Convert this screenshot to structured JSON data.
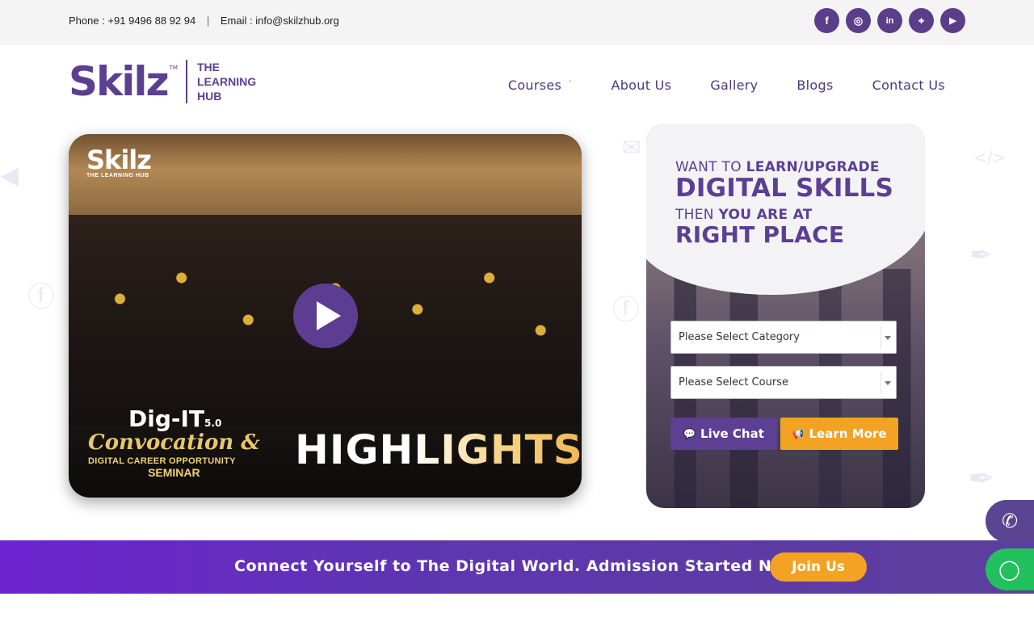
{
  "topbar": {
    "phone": "Phone : +91 9496 88 92 94",
    "separator": "|",
    "email": "Email : info@skilzhub.org",
    "social": [
      {
        "icon": "facebook-icon",
        "glyph": "f"
      },
      {
        "icon": "instagram-icon",
        "glyph": "◎"
      },
      {
        "icon": "linkedin-icon",
        "glyph": "in"
      },
      {
        "icon": "map-pin-icon",
        "glyph": "⌖"
      },
      {
        "icon": "youtube-icon",
        "glyph": "▶"
      }
    ]
  },
  "brand": {
    "logo_word": "Skilz",
    "logo_tm": "TM",
    "tagline_1": "THE",
    "tagline_2": "LEARNING",
    "tagline_3": "HUB",
    "color": "#5c3f93"
  },
  "nav": {
    "courses": "Courses",
    "about": "About Us",
    "gallery": "Gallery",
    "blogs": "Blogs",
    "contact": "Contact Us",
    "chevron": "˅"
  },
  "video": {
    "logo_word": "Skilz",
    "logo_tag": "THE LEARNING HUB",
    "event_title": "Dig-IT",
    "event_version": "5.0",
    "event_line2": "Convocation &",
    "event_line3": "DIGITAL CAREER OPPORTUNITY",
    "event_line4": "SEMINAR",
    "highlights": "HIGHLIGHTS",
    "play_icon": "play-icon"
  },
  "form": {
    "line1_light": "WANT TO ",
    "line1_bold": "LEARN/UPGRADE",
    "line2": "DIGITAL SKILLS",
    "line3_light": "THEN ",
    "line3_bold": "YOU ARE AT",
    "line4": "RIGHT PLACE",
    "category_placeholder": "Please Select Category",
    "course_placeholder": "Please Select Course",
    "live_chat": "Live Chat",
    "learn_more": "Learn More",
    "chat_glyph": "💬",
    "megaphone_glyph": "📢"
  },
  "banner": {
    "message": "Connect Yourself to The Digital World. Admission Started Now...",
    "join": "Join Us"
  },
  "floating": {
    "call_glyph": "✆",
    "whatsapp_glyph": "◯"
  },
  "colors": {
    "accent_purple": "#5c3f93",
    "accent_orange": "#f4a223",
    "whatsapp_green": "#22c15e"
  }
}
